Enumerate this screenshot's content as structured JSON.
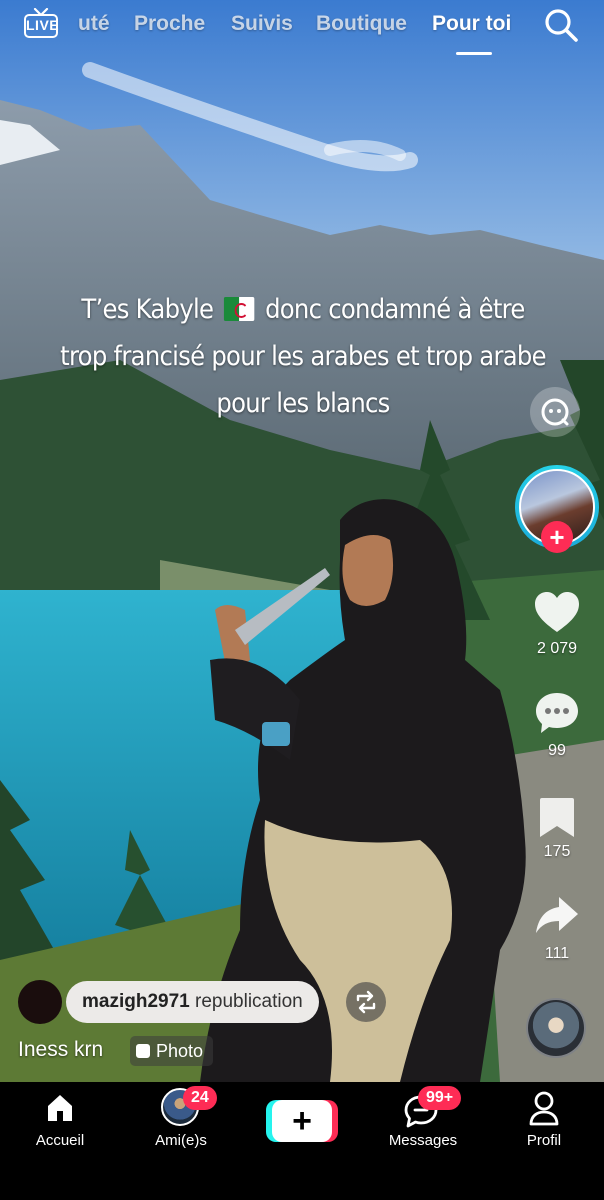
{
  "top_nav": {
    "live_label": "LIVE",
    "tabs": [
      {
        "label": "uté"
      },
      {
        "label": "Proche"
      },
      {
        "label": "Suivis"
      },
      {
        "label": "Boutique"
      },
      {
        "label": "Pour toi"
      }
    ],
    "active_tab": "Pour toi",
    "search_icon": "search-icon"
  },
  "post": {
    "caption_part1": "T’es Kabyle",
    "caption_flag": "algeria-flag-emoji",
    "caption_part2": "donc condamné à être trop francisé pour les arabes et trop arabe pour les blancs",
    "author": "Iness krn",
    "photo_tag": "Photo",
    "repost_text": "mazigh2971",
    "repost_suffix": "republication"
  },
  "actions": {
    "likes": "2 079",
    "comments": "99",
    "saves": "175",
    "shares": "111",
    "follow_symbol": "+"
  },
  "bottom_nav": {
    "items": [
      {
        "label": "Accueil",
        "icon": "home-icon"
      },
      {
        "label": "Ami(e)s",
        "icon": "friends-avatar"
      },
      {
        "label": "",
        "icon": "create-plus-icon"
      },
      {
        "label": "Messages",
        "icon": "messages-icon"
      },
      {
        "label": "Profil",
        "icon": "profile-icon"
      }
    ],
    "friends_badge": "24",
    "messages_badge": "99+",
    "plus_symbol": "+"
  },
  "colors": {
    "accent": "#fe2c55",
    "cyan": "#25f4ee",
    "nav_bg": "#000000"
  }
}
